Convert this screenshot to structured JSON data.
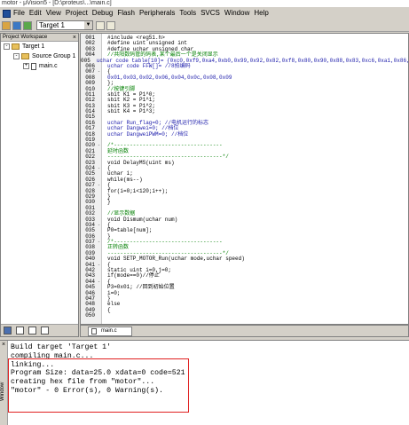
{
  "window": {
    "title": "motor - μVision5 - [D:\\proteus\\...\\main.c]"
  },
  "menu": {
    "items": [
      "File",
      "Edit",
      "View",
      "Project",
      "Debug",
      "Flash",
      "Peripherals",
      "Tools",
      "SVCS",
      "Window",
      "Help"
    ]
  },
  "toolbar": {
    "target": "Target 1"
  },
  "workspace": {
    "header": "Project Workspace",
    "close": "×",
    "tree": [
      {
        "toggle": "-",
        "label": "Target 1",
        "indent": 0,
        "icon": "folder-icon"
      },
      {
        "toggle": "-",
        "label": "Source Group 1",
        "indent": 1,
        "icon": "folder-icon"
      },
      {
        "toggle": "+",
        "label": "main.c",
        "indent": 2,
        "icon": "file-icon"
      }
    ]
  },
  "editor": {
    "tab_label": "main.c",
    "lines": [
      {
        "n": "001",
        "f": "",
        "t": "#include <reg51.h>",
        "c": "pp"
      },
      {
        "n": "002",
        "f": "",
        "t": "#define uint unsigned int",
        "c": "pp"
      },
      {
        "n": "003",
        "f": "",
        "t": "#define uchar unsigned char",
        "c": "pp"
      },
      {
        "n": "004",
        "f": "",
        "t": "//共阳数码管的码表,某个最后一个是关闭显示",
        "c": "cm"
      },
      {
        "n": "005",
        "f": "",
        "t": "uchar code table[10]= {0xc0,0xf9,0xa4,0xb0,0x99,0x92,0x82,0xf8,0x80,0x90,0x88,0x83,0xc6,0xa1,0x86,",
        "c": "bl"
      },
      {
        "n": "006",
        "f": "",
        "t": "uchar code FFW[]=   //8拍编码",
        "c": "bl"
      },
      {
        "n": "007",
        "f": "-",
        "t": "{",
        "c": "pp"
      },
      {
        "n": "008",
        "f": "",
        "t": "  0x01,0x03,0x02,0x06,0x04,0x0c,0x08,0x09",
        "c": "bl"
      },
      {
        "n": "009",
        "f": "",
        "t": "};",
        "c": "pp"
      },
      {
        "n": "010",
        "f": "",
        "t": "//按键引脚",
        "c": "cm"
      },
      {
        "n": "011",
        "f": "",
        "t": "sbit K1 = P1^0;",
        "c": "pp"
      },
      {
        "n": "012",
        "f": "",
        "t": "sbit K2 = P1^1;",
        "c": "pp"
      },
      {
        "n": "013",
        "f": "",
        "t": "sbit K3 = P1^2;",
        "c": "pp"
      },
      {
        "n": "014",
        "f": "",
        "t": "sbit K4 = P1^3;",
        "c": "pp"
      },
      {
        "n": "015",
        "f": "",
        "t": "",
        "c": "pp"
      },
      {
        "n": "016",
        "f": "",
        "t": "uchar Run_flag=0;  //电机运行的标志",
        "c": "bl"
      },
      {
        "n": "017",
        "f": "",
        "t": "uchar Dangwei=0;          //档位",
        "c": "bl"
      },
      {
        "n": "018",
        "f": "",
        "t": "uchar DangweiPWM=0;        //档位",
        "c": "bl"
      },
      {
        "n": "019",
        "f": "",
        "t": "",
        "c": "pp"
      },
      {
        "n": "020",
        "f": "-",
        "t": "/*----------------------------------",
        "c": "cm"
      },
      {
        "n": "021",
        "f": "",
        "t": "延时函数",
        "c": "cm"
      },
      {
        "n": "022",
        "f": "",
        "t": "------------------------------------*/",
        "c": "cm"
      },
      {
        "n": "023",
        "f": "",
        "t": "void DelayMS(uint ms)",
        "c": "pp"
      },
      {
        "n": "024",
        "f": "-",
        "t": "{",
        "c": "pp"
      },
      {
        "n": "025",
        "f": "",
        "t": "  uchar i;",
        "c": "pp"
      },
      {
        "n": "026",
        "f": "",
        "t": "  while(ms--)",
        "c": "pp"
      },
      {
        "n": "027",
        "f": "-",
        "t": "  {",
        "c": "pp"
      },
      {
        "n": "028",
        "f": "",
        "t": "    for(i=0;i<120;i++);",
        "c": "pp"
      },
      {
        "n": "029",
        "f": "",
        "t": "  }",
        "c": "pp"
      },
      {
        "n": "030",
        "f": "",
        "t": "}",
        "c": "pp"
      },
      {
        "n": "031",
        "f": "",
        "t": "",
        "c": "pp"
      },
      {
        "n": "032",
        "f": "",
        "t": "//显示数据",
        "c": "cm"
      },
      {
        "n": "033",
        "f": "",
        "t": "void Dismum(uchar num)",
        "c": "pp"
      },
      {
        "n": "034",
        "f": "-",
        "t": "{",
        "c": "pp"
      },
      {
        "n": "035",
        "f": "",
        "t": "  P0=table[num];",
        "c": "pp"
      },
      {
        "n": "036",
        "f": "",
        "t": "}",
        "c": "pp"
      },
      {
        "n": "037",
        "f": "-",
        "t": "/*----------------------------------",
        "c": "cm"
      },
      {
        "n": "038",
        "f": "",
        "t": "正转函数",
        "c": "cm"
      },
      {
        "n": "039",
        "f": "",
        "t": "------------------------------------*/",
        "c": "cm"
      },
      {
        "n": "040",
        "f": "",
        "t": "void SETP_MOTOR_Run(uchar mode,uchar speed)",
        "c": "pp"
      },
      {
        "n": "041",
        "f": "-",
        "t": "{",
        "c": "pp"
      },
      {
        "n": "042",
        "f": "",
        "t": "  static uint i=0,j=0;",
        "c": "pp"
      },
      {
        "n": "043",
        "f": "",
        "t": "  if(mode==0)//停止",
        "c": "pp"
      },
      {
        "n": "044",
        "f": "-",
        "t": "  {",
        "c": "pp"
      },
      {
        "n": "045",
        "f": "",
        "t": "    P3=0x01;  //回到初始位置",
        "c": "pp"
      },
      {
        "n": "046",
        "f": "",
        "t": "    i=0;",
        "c": "pp"
      },
      {
        "n": "047",
        "f": "",
        "t": "  }",
        "c": "pp"
      },
      {
        "n": "048",
        "f": "",
        "t": "  else",
        "c": "pp"
      },
      {
        "n": "049",
        "f": "",
        "t": "  {",
        "c": "pp"
      },
      {
        "n": "050",
        "f": "",
        "t": "",
        "c": "pp"
      }
    ]
  },
  "output": {
    "close": "×",
    "side_label": "Window",
    "lines": [
      "Build target 'Target 1'",
      "compiling main.c...",
      "linking...",
      "Program Size: data=25.0 xdata=0 code=521",
      "creating hex file from \"motor\"...",
      "\"motor\" - 0 Error(s), 0 Warning(s)."
    ]
  },
  "colors": {
    "highlight_box": "#e02020"
  }
}
